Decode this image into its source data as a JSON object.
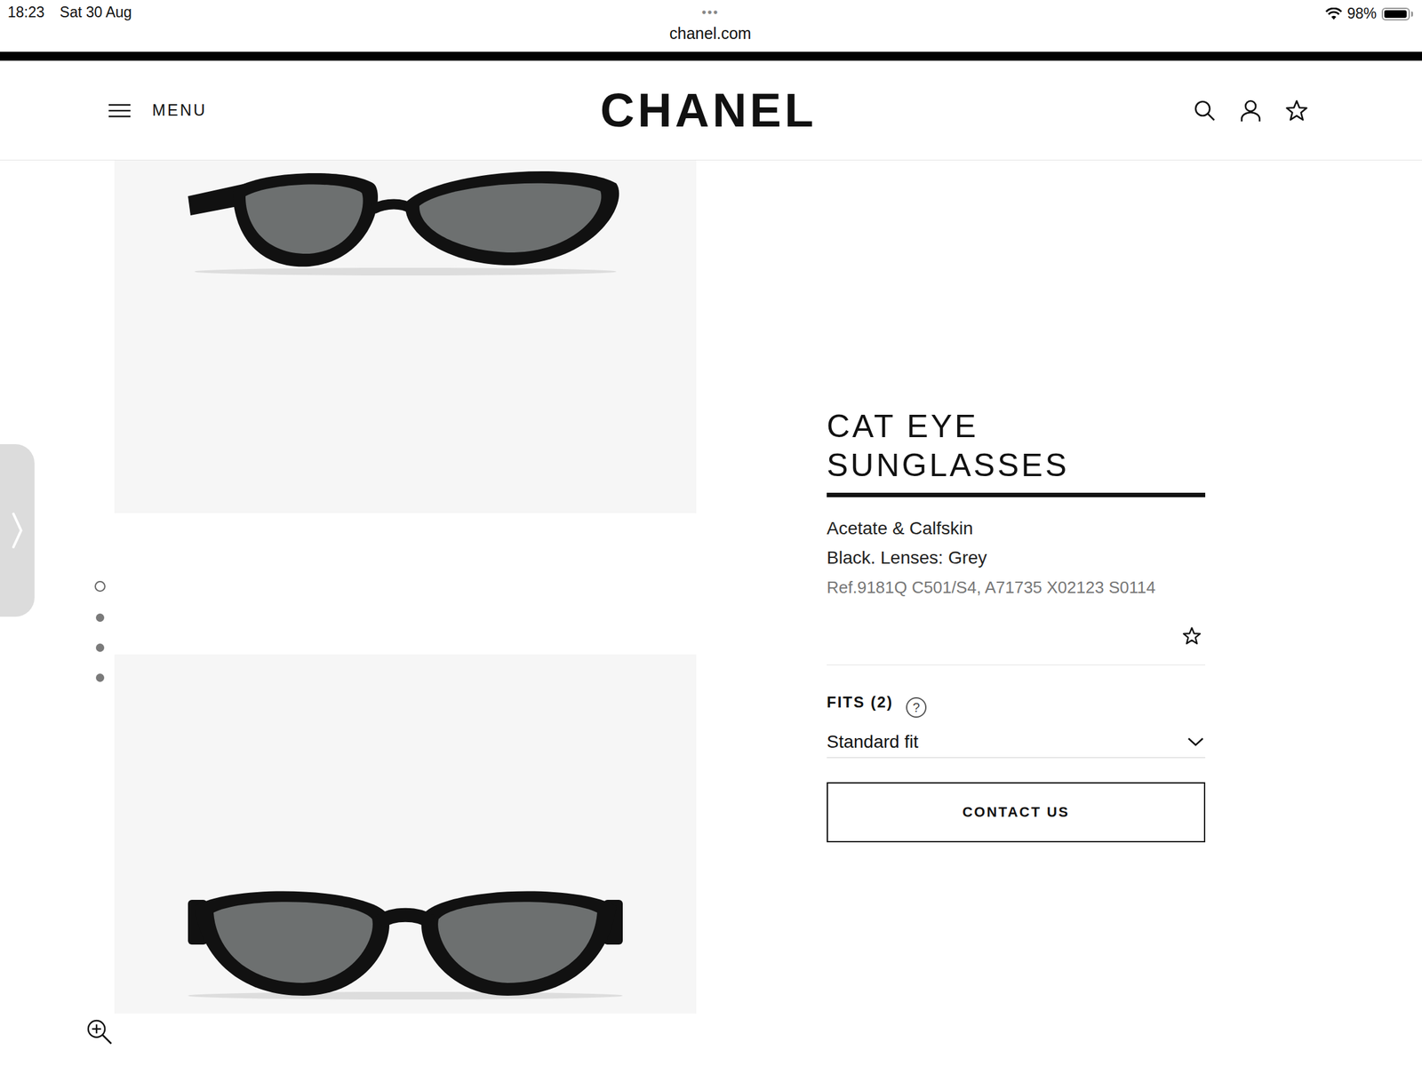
{
  "status_bar": {
    "time": "18:23",
    "date": "Sat 30 Aug",
    "more": "•••",
    "battery": "98%",
    "battery_level": 0.98
  },
  "address_bar": {
    "url": "chanel.com"
  },
  "header": {
    "menu_label": "MENU",
    "logo": "CHANEL"
  },
  "gallery": {
    "dots": [
      {
        "selected": true
      },
      {
        "selected": false
      },
      {
        "selected": false
      },
      {
        "selected": false
      }
    ]
  },
  "product": {
    "title_lines": [
      "CAT EYE",
      "SUNGLASSES"
    ],
    "material": "Acetate & Calfskin",
    "colour": "Black. Lenses: Grey",
    "reference": "Ref.9181Q C501/S4, A71735 X02123 S0114",
    "fits_label": "FITS (2)",
    "fits_help": "?",
    "fit_selected": "Standard fit",
    "button": "CONTACT US"
  }
}
